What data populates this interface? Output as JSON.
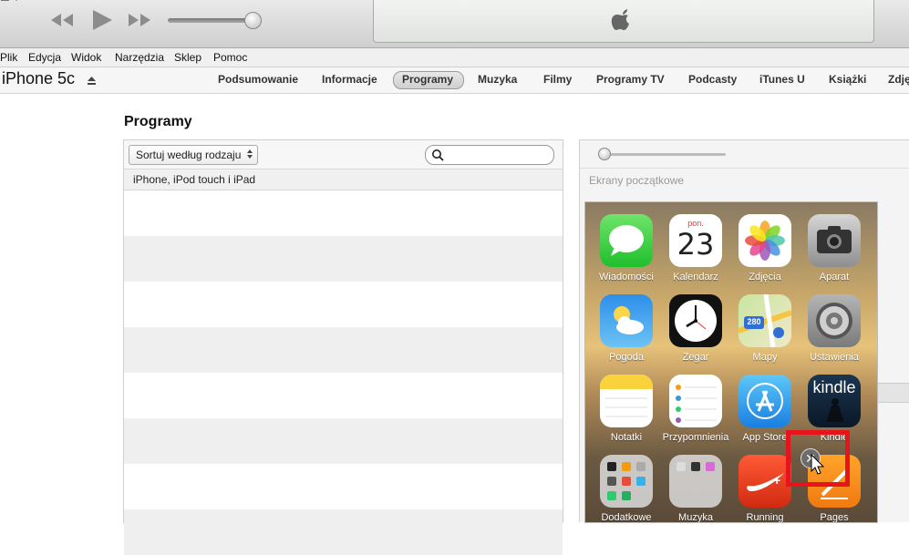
{
  "menu": [
    "Plik",
    "Edycja",
    "Widok",
    "Narzędzia",
    "Sklep",
    "Pomoc"
  ],
  "device": {
    "name": "iPhone 5c"
  },
  "tabs": [
    "Podsumowanie",
    "Informacje",
    "Programy",
    "Muzyka",
    "Filmy",
    "Programy TV",
    "Podcasty",
    "iTunes U",
    "Książki",
    "Zdję"
  ],
  "active_tab": "Programy",
  "page": {
    "title": "Programy"
  },
  "apps_list": {
    "sort_label": "Sortuj według rodzaju",
    "search_placeholder": "",
    "section": "iPhone, iPod touch i iPad"
  },
  "homescreen": {
    "label": "Ekrany początkowe",
    "apps": [
      {
        "label": "Wiadomości",
        "icon": "messages-icon"
      },
      {
        "label": "Kalendarz",
        "icon": "calendar-icon",
        "day": "pon.",
        "date": "23"
      },
      {
        "label": "Zdjęcia",
        "icon": "photos-icon"
      },
      {
        "label": "Aparat",
        "icon": "camera-icon"
      },
      {
        "label": "Pogoda",
        "icon": "weather-icon"
      },
      {
        "label": "Zegar",
        "icon": "clock-icon"
      },
      {
        "label": "Mapy",
        "icon": "maps-icon",
        "badge": "280"
      },
      {
        "label": "Ustawienia",
        "icon": "settings-icon"
      },
      {
        "label": "Notatki",
        "icon": "notes-icon"
      },
      {
        "label": "Przypomnienia",
        "icon": "reminders-icon"
      },
      {
        "label": "App Store",
        "icon": "appstore-icon"
      },
      {
        "label": "Kindle",
        "icon": "kindle-icon",
        "icon_text": "kindle"
      },
      {
        "label": "Dodatkowe",
        "icon": "folder-icon"
      },
      {
        "label": "Muzyka",
        "icon": "folder-icon"
      },
      {
        "label": "Running",
        "icon": "nike-running-icon",
        "icon_text": "+"
      },
      {
        "label": "Pages",
        "icon": "pages-icon"
      }
    ]
  },
  "colors": {
    "highlight": "#e8141c",
    "toolbar": "#dcdcdc"
  }
}
